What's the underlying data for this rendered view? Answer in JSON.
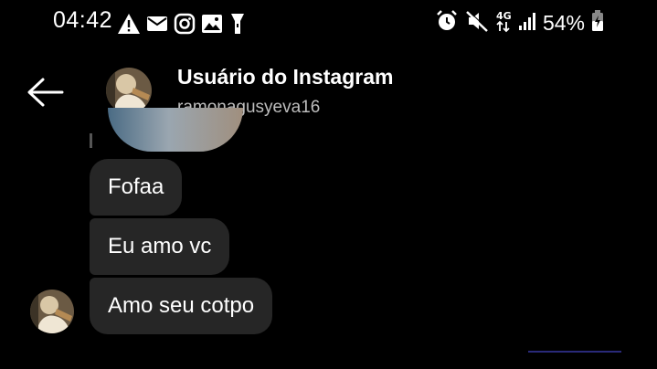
{
  "status_bar": {
    "time": "04:42",
    "notification_icons": [
      "warning-icon",
      "mail-icon",
      "instagram-icon",
      "gallery-icon",
      "flashlight-icon"
    ],
    "system_icons": [
      "alarm-icon",
      "mute-icon",
      "network-4g-icon",
      "signal-icon"
    ],
    "battery_percent": "54%"
  },
  "header": {
    "back_icon": "arrow-left-icon",
    "name": "Usuário do Instagram",
    "username": "ramonagusyeva16"
  },
  "messages": [
    {
      "text": "Fofaa"
    },
    {
      "text": "Eu amo vc"
    },
    {
      "text": "Amo seu cotpo"
    }
  ],
  "colors": {
    "background": "#000000",
    "bubble": "#262626",
    "text": "#ffffff",
    "subtext": "#bdbdbd"
  }
}
